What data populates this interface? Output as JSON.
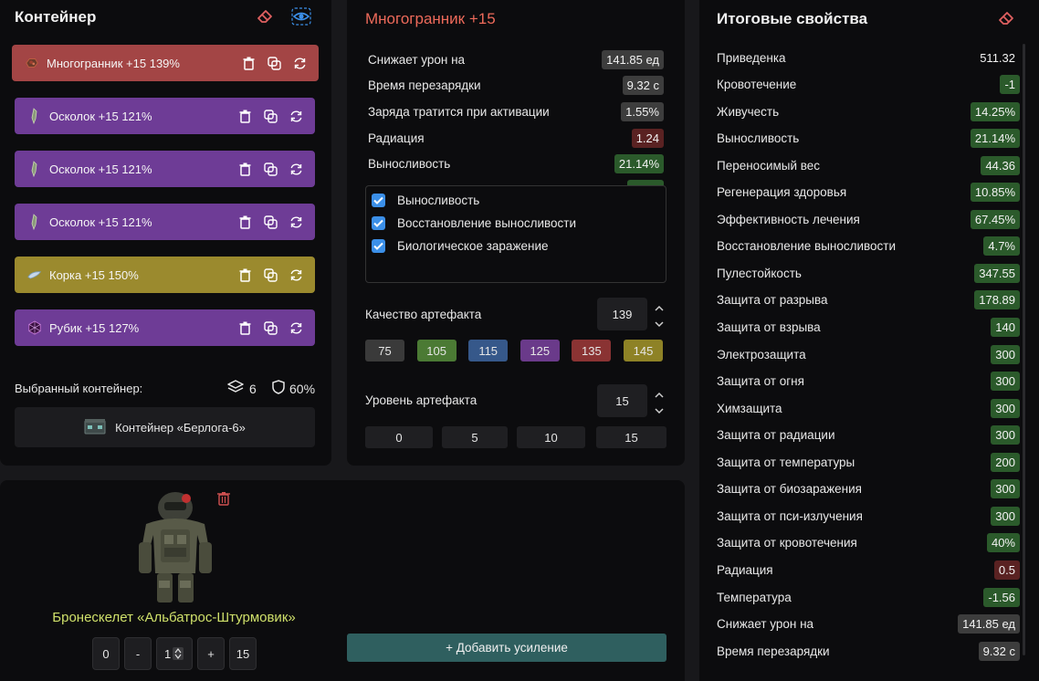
{
  "container": {
    "title": "Контейнер",
    "artifacts": [
      {
        "label": "Многогранник +15 139%",
        "color": "#a34545",
        "icon": "polyhedron-icon",
        "selected": true
      },
      {
        "label": "Осколок +15 121%",
        "color": "#6e3c96",
        "icon": "shard-icon"
      },
      {
        "label": "Осколок +15 121%",
        "color": "#6e3c96",
        "icon": "shard-icon"
      },
      {
        "label": "Осколок +15 121%",
        "color": "#6e3c96",
        "icon": "shard-icon"
      },
      {
        "label": "Корка +15 150%",
        "color": "#9b8a2e",
        "icon": "crust-icon"
      },
      {
        "label": "Рубик +15 127%",
        "color": "#6e3c96",
        "icon": "rubik-icon"
      }
    ],
    "selected_label": "Выбранный контейнер:",
    "slots": "6",
    "protection": "60%",
    "container_name": "Контейнер «Берлога-6»"
  },
  "artifact": {
    "title": "Многогранник +15",
    "stats": [
      {
        "label": "Снижает урон на",
        "value": "141.85 ед",
        "style": "gray"
      },
      {
        "label": "Время перезарядки",
        "value": "9.32 с",
        "style": "gray"
      },
      {
        "label": "Заряда тратится при активации",
        "value": "1.55%",
        "style": "gray"
      },
      {
        "label": "Радиация",
        "value": "1.24",
        "style": "red"
      },
      {
        "label": "Выносливость",
        "value": "21.14%",
        "style": "green"
      }
    ],
    "checks": [
      "Выносливость",
      "Восстановление выносливости",
      "Биологическое заражение"
    ],
    "quality_label": "Качество артефакта",
    "quality_value": "139",
    "quality_presets": [
      {
        "label": "75",
        "color": "#3a3a3a"
      },
      {
        "label": "105",
        "color": "#4b7a34"
      },
      {
        "label": "115",
        "color": "#36588a"
      },
      {
        "label": "125",
        "color": "#6a3a8a"
      },
      {
        "label": "135",
        "color": "#8a3333"
      },
      {
        "label": "145",
        "color": "#8e8226"
      }
    ],
    "level_label": "Уровень артефакта",
    "level_value": "15",
    "level_presets": [
      "0",
      "5",
      "10",
      "15"
    ]
  },
  "armor": {
    "name": "Бронескелет «Альбатрос-Штурмовик»",
    "name_color": "#cfe06a",
    "minus_zero": "0",
    "minus": "-",
    "level": "1",
    "plus": "+",
    "max": "15",
    "add_button": "+ Добавить усиление"
  },
  "totals": {
    "title": "Итоговые свойства",
    "rows": [
      {
        "label": "Приведенка",
        "value": "511.32",
        "style": "none"
      },
      {
        "label": "Кровотечение",
        "value": "-1",
        "style": "green"
      },
      {
        "label": "Живучесть",
        "value": "14.25%",
        "style": "green"
      },
      {
        "label": "Выносливость",
        "value": "21.14%",
        "style": "green"
      },
      {
        "label": "Переносимый вес",
        "value": "44.36",
        "style": "green"
      },
      {
        "label": "Регенерация здоровья",
        "value": "10.85%",
        "style": "green"
      },
      {
        "label": "Эффективность лечения",
        "value": "67.45%",
        "style": "green"
      },
      {
        "label": "Восстановление выносливости",
        "value": "4.7%",
        "style": "green"
      },
      {
        "label": "Пулестойкость",
        "value": "347.55",
        "style": "green"
      },
      {
        "label": "Защита от разрыва",
        "value": "178.89",
        "style": "green"
      },
      {
        "label": "Защита от взрыва",
        "value": "140",
        "style": "green"
      },
      {
        "label": "Электрозащита",
        "value": "300",
        "style": "green"
      },
      {
        "label": "Защита от огня",
        "value": "300",
        "style": "green"
      },
      {
        "label": "Химзащита",
        "value": "300",
        "style": "green"
      },
      {
        "label": "Защита от радиации",
        "value": "300",
        "style": "green"
      },
      {
        "label": "Защита от температуры",
        "value": "200",
        "style": "green"
      },
      {
        "label": "Защита от биозаражения",
        "value": "300",
        "style": "green"
      },
      {
        "label": "Защита от пси-излучения",
        "value": "300",
        "style": "green"
      },
      {
        "label": "Защита от кровотечения",
        "value": "40%",
        "style": "green"
      },
      {
        "label": "Радиация",
        "value": "0.5",
        "style": "red"
      },
      {
        "label": "Температура",
        "value": "-1.56",
        "style": "green"
      },
      {
        "label": "Снижает урон на",
        "value": "141.85 ед",
        "style": "gray"
      },
      {
        "label": "Время перезарядки",
        "value": "9.32 с",
        "style": "gray"
      }
    ]
  }
}
